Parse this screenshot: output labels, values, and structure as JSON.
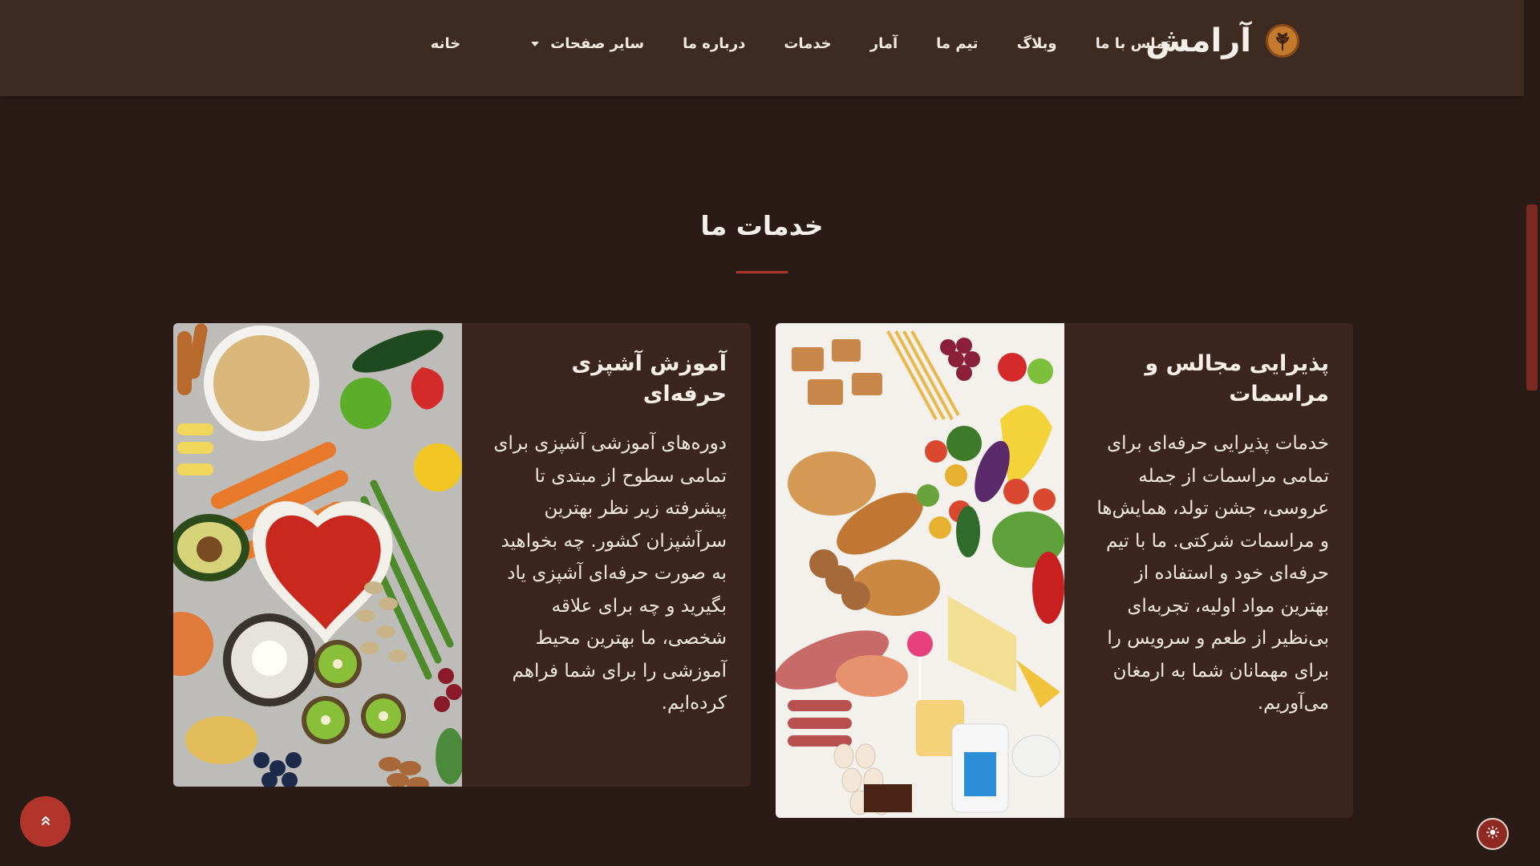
{
  "header": {
    "brand": "آرامش",
    "logo_icon": "wheat-icon",
    "nav": [
      {
        "label": "خانه"
      },
      {
        "label": "سایر صفحات",
        "has_dropdown": true
      },
      {
        "label": "درباره ما"
      },
      {
        "label": "خدمات"
      },
      {
        "label": "آمار"
      },
      {
        "label": "تیم ما"
      },
      {
        "label": "وبلاگ"
      },
      {
        "label": "تماس با ما"
      }
    ]
  },
  "services": {
    "title": "خدمات ما",
    "cards": [
      {
        "title": "پذیرایی مجالس و مراسمات",
        "text": "خدمات پذیرایی حرفه‌ای برای تمامی مراسمات از جمله عروسی، جشن تولد، همایش‌ها و مراسمات شرکتی. ما با تیم حرفه‌ای خود و استفاده از بهترین مواد اولیه، تجربه‌ای بی‌نظیر از طعم و سرویس را برای مهمانان شما به ارمغان می‌آوریم."
      },
      {
        "title": "آموزش آشپزی حرفه‌ای",
        "text": "دوره‌های آموزشی آشپزی برای تمامی سطوح از مبتدی تا پیشرفته زیر نظر بهترین سرآشپزان کشور. چه بخواهید به صورت حرفه‌ای آشپزی یاد بگیرید و چه برای علاقه شخصی، ما بهترین محیط آموزشی را برای شما فراهم کرده‌ایم."
      }
    ]
  },
  "colors": {
    "background": "#2b1b16",
    "navbar": "#3d2a21",
    "card": "#3a261e",
    "accent": "#b1352b"
  },
  "controls": {
    "back_to_top_icon": "double-chevron-up-icon",
    "theme_toggle_icon": "sun-icon"
  }
}
